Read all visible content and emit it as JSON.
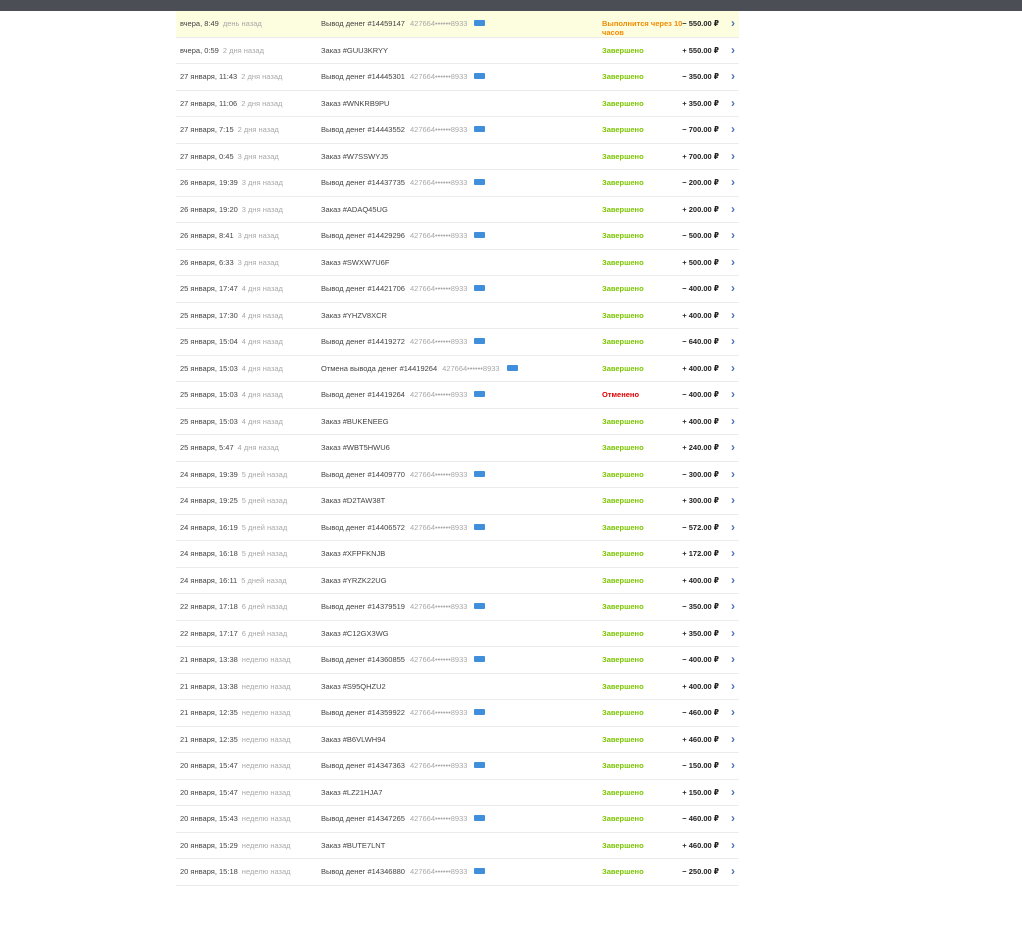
{
  "colors": {
    "topbar": "#4b4e55",
    "success": "#7cc600",
    "cancelled": "#e00000",
    "pending": "#f08c00",
    "pending_row": "#fdfde0",
    "card_icon": "#3f8fdc"
  },
  "icons": {
    "card": "credit-card-icon",
    "chevron": "chevron-right-icon"
  },
  "transactions": [
    {
      "date": "вчера, 8:49",
      "rel": "день назад",
      "desc": "Вывод денег #14459147",
      "card": "427664••••••8933",
      "status": "Выполнится через 10 часов",
      "kind": "pending",
      "amount": "− 550.00 ₽"
    },
    {
      "date": "вчера, 0:59",
      "rel": "2 дня назад",
      "desc": "Заказ #GUU3KRYY",
      "card": "",
      "status": "Завершено",
      "kind": "ok",
      "amount": "+ 550.00 ₽"
    },
    {
      "date": "27 января, 11:43",
      "rel": "2 дня назад",
      "desc": "Вывод денег #14445301",
      "card": "427664••••••8933",
      "status": "Завершено",
      "kind": "ok",
      "amount": "− 350.00 ₽"
    },
    {
      "date": "27 января, 11:06",
      "rel": "2 дня назад",
      "desc": "Заказ #WNKRB9PU",
      "card": "",
      "status": "Завершено",
      "kind": "ok",
      "amount": "+ 350.00 ₽"
    },
    {
      "date": "27 января, 7:15",
      "rel": "2 дня назад",
      "desc": "Вывод денег #14443552",
      "card": "427664••••••8933",
      "status": "Завершено",
      "kind": "ok",
      "amount": "− 700.00 ₽"
    },
    {
      "date": "27 января, 0:45",
      "rel": "3 дня назад",
      "desc": "Заказ #W7SSWYJ5",
      "card": "",
      "status": "Завершено",
      "kind": "ok",
      "amount": "+ 700.00 ₽"
    },
    {
      "date": "26 января, 19:39",
      "rel": "3 дня назад",
      "desc": "Вывод денег #14437735",
      "card": "427664••••••8933",
      "status": "Завершено",
      "kind": "ok",
      "amount": "− 200.00 ₽"
    },
    {
      "date": "26 января, 19:20",
      "rel": "3 дня назад",
      "desc": "Заказ #ADAQ45UG",
      "card": "",
      "status": "Завершено",
      "kind": "ok",
      "amount": "+ 200.00 ₽"
    },
    {
      "date": "26 января, 8:41",
      "rel": "3 дня назад",
      "desc": "Вывод денег #14429296",
      "card": "427664••••••8933",
      "status": "Завершено",
      "kind": "ok",
      "amount": "− 500.00 ₽"
    },
    {
      "date": "26 января, 6:33",
      "rel": "3 дня назад",
      "desc": "Заказ #SWXW7U6F",
      "card": "",
      "status": "Завершено",
      "kind": "ok",
      "amount": "+ 500.00 ₽"
    },
    {
      "date": "25 января, 17:47",
      "rel": "4 дня назад",
      "desc": "Вывод денег #14421706",
      "card": "427664••••••8933",
      "status": "Завершено",
      "kind": "ok",
      "amount": "− 400.00 ₽"
    },
    {
      "date": "25 января, 17:30",
      "rel": "4 дня назад",
      "desc": "Заказ #YHZV8XCR",
      "card": "",
      "status": "Завершено",
      "kind": "ok",
      "amount": "+ 400.00 ₽"
    },
    {
      "date": "25 января, 15:04",
      "rel": "4 дня назад",
      "desc": "Вывод денег #14419272",
      "card": "427664••••••8933",
      "status": "Завершено",
      "kind": "ok",
      "amount": "− 640.00 ₽"
    },
    {
      "date": "25 января, 15:03",
      "rel": "4 дня назад",
      "desc": "Отмена вывода денег #14419264",
      "card": "427664••••••8933",
      "status": "Завершено",
      "kind": "ok",
      "amount": "+ 400.00 ₽"
    },
    {
      "date": "25 января, 15:03",
      "rel": "4 дня назад",
      "desc": "Вывод денег #14419264",
      "card": "427664••••••8933",
      "status": "Отменено",
      "kind": "cancel",
      "amount": "− 400.00 ₽"
    },
    {
      "date": "25 января, 15:03",
      "rel": "4 дня назад",
      "desc": "Заказ #BUKENEEG",
      "card": "",
      "status": "Завершено",
      "kind": "ok",
      "amount": "+ 400.00 ₽"
    },
    {
      "date": "25 января, 5:47",
      "rel": "4 дня назад",
      "desc": "Заказ #WBT5HWU6",
      "card": "",
      "status": "Завершено",
      "kind": "ok",
      "amount": "+ 240.00 ₽"
    },
    {
      "date": "24 января, 19:39",
      "rel": "5 дней назад",
      "desc": "Вывод денег #14409770",
      "card": "427664••••••8933",
      "status": "Завершено",
      "kind": "ok",
      "amount": "− 300.00 ₽"
    },
    {
      "date": "24 января, 19:25",
      "rel": "5 дней назад",
      "desc": "Заказ #D2TAW38T",
      "card": "",
      "status": "Завершено",
      "kind": "ok",
      "amount": "+ 300.00 ₽"
    },
    {
      "date": "24 января, 16:19",
      "rel": "5 дней назад",
      "desc": "Вывод денег #14406572",
      "card": "427664••••••8933",
      "status": "Завершено",
      "kind": "ok",
      "amount": "− 572.00 ₽"
    },
    {
      "date": "24 января, 16:18",
      "rel": "5 дней назад",
      "desc": "Заказ #XFPFKNJB",
      "card": "",
      "status": "Завершено",
      "kind": "ok",
      "amount": "+ 172.00 ₽"
    },
    {
      "date": "24 января, 16:11",
      "rel": "5 дней назад",
      "desc": "Заказ #YRZK22UG",
      "card": "",
      "status": "Завершено",
      "kind": "ok",
      "amount": "+ 400.00 ₽"
    },
    {
      "date": "22 января, 17:18",
      "rel": "6 дней назад",
      "desc": "Вывод денег #14379519",
      "card": "427664••••••8933",
      "status": "Завершено",
      "kind": "ok",
      "amount": "− 350.00 ₽"
    },
    {
      "date": "22 января, 17:17",
      "rel": "6 дней назад",
      "desc": "Заказ #C12GX3WG",
      "card": "",
      "status": "Завершено",
      "kind": "ok",
      "amount": "+ 350.00 ₽"
    },
    {
      "date": "21 января, 13:38",
      "rel": "неделю назад",
      "desc": "Вывод денег #14360855",
      "card": "427664••••••8933",
      "status": "Завершено",
      "kind": "ok",
      "amount": "− 400.00 ₽"
    },
    {
      "date": "21 января, 13:38",
      "rel": "неделю назад",
      "desc": "Заказ #S95QHZU2",
      "card": "",
      "status": "Завершено",
      "kind": "ok",
      "amount": "+ 400.00 ₽"
    },
    {
      "date": "21 января, 12:35",
      "rel": "неделю назад",
      "desc": "Вывод денег #14359922",
      "card": "427664••••••8933",
      "status": "Завершено",
      "kind": "ok",
      "amount": "− 460.00 ₽"
    },
    {
      "date": "21 января, 12:35",
      "rel": "неделю назад",
      "desc": "Заказ #B6VLWH94",
      "card": "",
      "status": "Завершено",
      "kind": "ok",
      "amount": "+ 460.00 ₽"
    },
    {
      "date": "20 января, 15:47",
      "rel": "неделю назад",
      "desc": "Вывод денег #14347363",
      "card": "427664••••••8933",
      "status": "Завершено",
      "kind": "ok",
      "amount": "− 150.00 ₽"
    },
    {
      "date": "20 января, 15:47",
      "rel": "неделю назад",
      "desc": "Заказ #LZ21HJA7",
      "card": "",
      "status": "Завершено",
      "kind": "ok",
      "amount": "+ 150.00 ₽"
    },
    {
      "date": "20 января, 15:43",
      "rel": "неделю назад",
      "desc": "Вывод денег #14347265",
      "card": "427664••••••8933",
      "status": "Завершено",
      "kind": "ok",
      "amount": "− 460.00 ₽"
    },
    {
      "date": "20 января, 15:29",
      "rel": "неделю назад",
      "desc": "Заказ #BUTE7LNT",
      "card": "",
      "status": "Завершено",
      "kind": "ok",
      "amount": "+ 460.00 ₽"
    },
    {
      "date": "20 января, 15:18",
      "rel": "неделю назад",
      "desc": "Вывод денег #14346880",
      "card": "427664••••••8933",
      "status": "Завершено",
      "kind": "ok",
      "amount": "− 250.00 ₽"
    }
  ]
}
